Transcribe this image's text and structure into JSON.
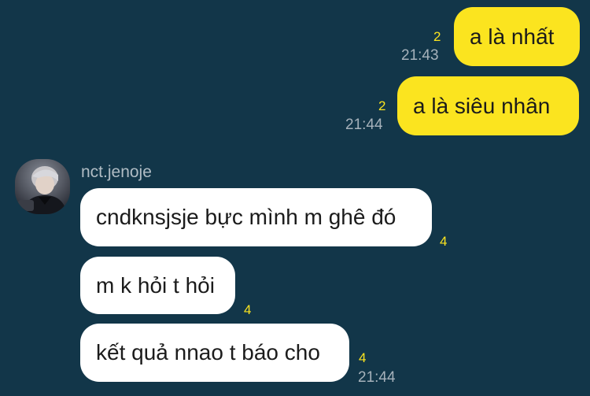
{
  "colors": {
    "background": "#123649",
    "sent_bubble": "#fbe41f",
    "received_bubble": "#ffffff",
    "unread_count": "#fbe41f",
    "timestamp": "#a6b2bb"
  },
  "messages_sent": [
    {
      "text": "a là nhất",
      "unread": "2",
      "time": "21:43"
    },
    {
      "text": "a là siêu nhân",
      "unread": "2",
      "time": "21:44"
    }
  ],
  "received_group": {
    "sender": "nct.jenoje",
    "avatar_icon": "profile-photo",
    "messages": [
      {
        "text": "cndknsjsje bực mình m ghê đó",
        "unread": "4"
      },
      {
        "text": "m k hỏi t hỏi",
        "unread": "4"
      },
      {
        "text": "kết quả nnao t báo cho",
        "unread": "4",
        "time": "21:44"
      }
    ]
  }
}
